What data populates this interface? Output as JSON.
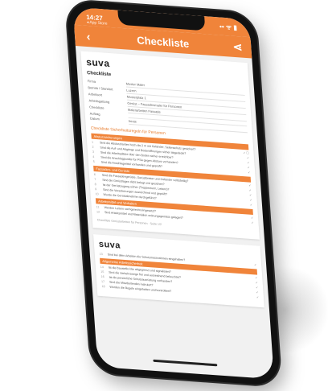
{
  "status": {
    "time": "14:27",
    "sub": "◂ App Store",
    "icons": "•• ᯤ ▮"
  },
  "appbar": {
    "back_icon": "chevron-left-icon",
    "title": "Checkliste",
    "share_icon": "share-icon"
  },
  "doc1": {
    "logo": "suva",
    "heading": "Checkliste",
    "fields": [
      {
        "k": "Firma",
        "v": "Muster Maler"
      },
      {
        "k": "Betrieb / Standort",
        "v": "Luzern"
      },
      {
        "k": "Arbeitsort",
        "v": "Musterplatz 1"
      },
      {
        "k": "Arbeitsgattung",
        "v": "Gerüst – Fassadenmaler für Personen"
      },
      {
        "k": "Checkliste",
        "v": "Malerarbeiten Fassade"
      },
      {
        "k": "Auftrag",
        "v": ""
      },
      {
        "k": "Datum",
        "v": "heute"
      }
    ],
    "section_title": "Checkliste Sicherheitsregeln für Personen",
    "sections": [
      {
        "bar": "Absturzsicherungen",
        "items": [
          {
            "n": "1",
            "t": "Sind die Absturzkanten hoch als 2 m mit Geländer, Seitenschutz gesichert?",
            "c": "✓ ☐"
          },
          {
            "n": "2",
            "t": "Sind die Auf- und Abgänge und Bodenöffnungen sicher abgedeckt?",
            "c": "✓"
          },
          {
            "n": "3",
            "t": "Sind die Arbeitsplätze über den Boden sicher erreichbar?",
            "c": "✓"
          },
          {
            "n": "4",
            "t": "Sind die Anschlagpunkte für PSA gegen Absturz vorhanden?",
            "c": "✓"
          },
          {
            "n": "5",
            "t": "Sind die Anschlagmittel vorhanden und geprüft?",
            "c": "✓"
          }
        ]
      },
      {
        "bar": "Fassaden- und Gerüste",
        "items": [
          {
            "n": "6",
            "t": "Sind die Fassadengerüste, Gerüstbretter und Geländer vollständig?",
            "c": "✓"
          },
          {
            "n": "7",
            "t": "Sind die Gerüstlagen dicht belegt und gesichert?",
            "c": "✓"
          },
          {
            "n": "8",
            "t": "Ist der Gerüstzugang sicher (Treppenturm, Leitern)?",
            "c": "✓"
          },
          {
            "n": "9",
            "t": "Sind die Verankerungen ausreichend und geprüft?",
            "c": "✓"
          },
          {
            "n": "10",
            "t": "Wurde die Gerüstabnahme durchgeführt?",
            "c": "✓"
          }
        ]
      },
      {
        "bar": "Arbeitsmittel und Verhalten",
        "items": [
          {
            "n": "11",
            "t": "Werden Leitern sachgerecht eingesetzt?",
            "c": "✓"
          },
          {
            "n": "12",
            "t": "Sind Arbeitsmittel und Materialien ordnungsgemäss gelagert?",
            "c": "✓"
          }
        ]
      }
    ],
    "footer": "Checkliste Gerüstarbeiten für Personen · Seite 1/2"
  },
  "doc2": {
    "logo": "suva",
    "sections": [
      {
        "bar": "",
        "items": [
          {
            "n": "13",
            "t": "Sind bei allen Arbeiten die Schutzmassnahmen eingehalten?",
            "c": "✓"
          }
        ]
      },
      {
        "bar": "Allgemeine Arbeitssicherheit",
        "items": [
          {
            "n": "14",
            "t": "Ist die Baustelle klar abgegrenzt und signalisiert?",
            "c": "✓"
          },
          {
            "n": "15",
            "t": "Sind die Verkehrswege frei und ausreichend beleuchtet?",
            "c": "✓"
          },
          {
            "n": "16",
            "t": "Ist die persönliche Schutzausrüstung vorhanden?",
            "c": "✓"
          },
          {
            "n": "17",
            "t": "Sind die Mitarbeitenden instruiert?",
            "c": "✓"
          },
          {
            "n": "18",
            "t": "Werden die Regeln eingehalten und kontrolliert?",
            "c": "✓"
          }
        ]
      }
    ]
  }
}
